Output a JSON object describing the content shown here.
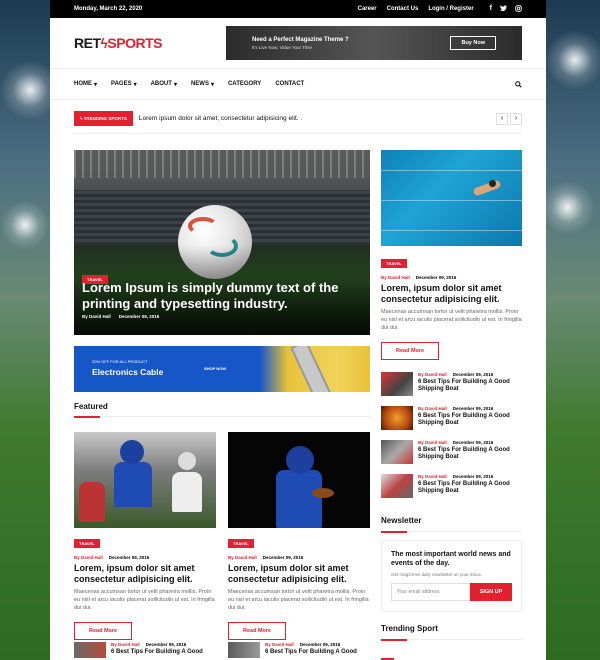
{
  "topbar": {
    "date": "Monday, March 22, 2020",
    "links": [
      "Career",
      "Contact Us",
      "Login / Register"
    ],
    "social": [
      "f",
      "t",
      "i"
    ]
  },
  "logo": {
    "part1": "RET",
    "part2": "SPORTS"
  },
  "header_ad": {
    "title": "Need a Perfect Magazine Theme ?",
    "subtitle": "It's Live Now, Value Your Time",
    "button": "Buy Now"
  },
  "nav": {
    "items": [
      "HOME",
      "PAGES",
      "ABOUT",
      "NEWS",
      "CATEGORY",
      "CONTACT"
    ]
  },
  "ticker": {
    "label": "TRENDING SPORTS",
    "text": "Lorem ipsum dolor sit amet, consectetur adipisicing elit. ."
  },
  "hero": {
    "tag": "TRAVEL",
    "title": "Lorem Ipsum is simply dummy text of the printing and typesetting industry.",
    "author": "By David Hall",
    "date": "December 09, 2016"
  },
  "promo": {
    "offer": "20% OFF FOR ALL PRODUCT",
    "title": "Electronics Cable",
    "cta": "SHOP NOW"
  },
  "featured": {
    "heading": "Featured",
    "cards": [
      {
        "tag": "TRAVEL",
        "author": "By David Hall",
        "date": "December 09, 2016",
        "title": "Lorem, ipsum dolor sit amet consectetur adipisicing elit.",
        "desc": "Maecenas accumsan tortor ut velit pharetra mollis. Proin eu nisl et arcu iaculis placerat sollicitudin ut est. In fringilla dui dui.",
        "button": "Read More"
      },
      {
        "tag": "TRAVEL",
        "author": "By David Hall",
        "date": "December 09, 2016",
        "title": "Lorem, ipsum dolor sit amet consectetur adipisicing elit.",
        "desc": "Maecenas accumsan tortor ut velit pharetra mollis. Proin eu nisl et arcu iaculis placerat sollicitudin ut est. In fringilla dui dui.",
        "button": "Read More"
      }
    ],
    "bottom": [
      {
        "author": "By David Hall",
        "date": "December 09, 2016",
        "title": "6 Best Tips For Building A Good"
      },
      {
        "author": "By David Hall",
        "date": "December 09, 2016",
        "title": "6 Best Tips For Building A Good"
      }
    ]
  },
  "side_feature": {
    "tag": "TRAVEL",
    "author": "By David Hall",
    "date": "December 09, 2016",
    "title": "Lorem, ipsum dolor sit amet consectetur adipisicing elit.",
    "desc": "Maecenas accumsan tortor ut velit pharetra mollis. Proin eu nisl et arcu iaculis placerat sollicitudin ut est. In fringilla dui dui.",
    "button": "Read More"
  },
  "side_list": [
    {
      "author": "By David Hall",
      "date": "December 09, 2016",
      "title": "6 Best Tips For Building A Good Shipping Boat"
    },
    {
      "author": "By David Hall",
      "date": "December 09, 2016",
      "title": "6 Best Tips For Building A Good Shipping Boat"
    },
    {
      "author": "By David Hall",
      "date": "December 09, 2016",
      "title": "6 Best Tips For Building A Good Shipping Boat"
    },
    {
      "author": "By David Hall",
      "date": "December 09, 2016",
      "title": "6 Best Tips For Building A Good Shipping Boat"
    }
  ],
  "newsletter": {
    "heading": "Newsletter",
    "title": "The most important world news and events of the day.",
    "subtitle": "Get magzrenvi daily newsletter on your inbox.",
    "placeholder": "Your email address",
    "button": "SIGN UP"
  },
  "trending": {
    "heading": "Trending Sport"
  },
  "colors": {
    "accent": "#e2202f",
    "topbar": "#000000",
    "promo": "#1657c8"
  }
}
